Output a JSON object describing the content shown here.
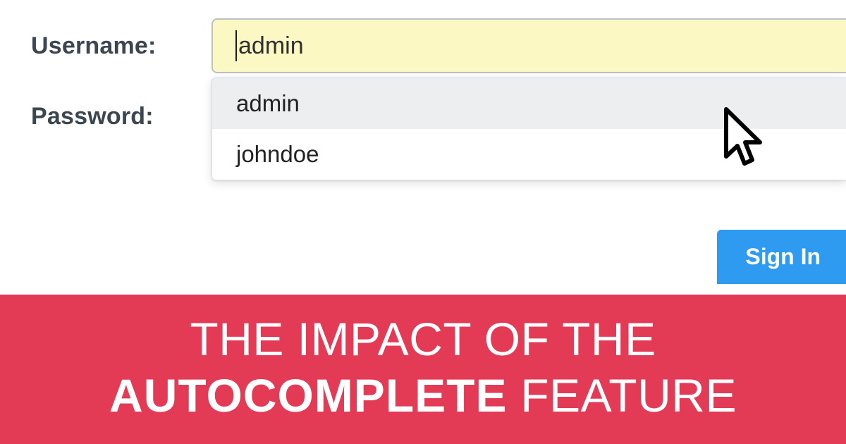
{
  "form": {
    "username_label": "Username:",
    "password_label": "Password:",
    "username_value": "admin"
  },
  "autocomplete": {
    "items": [
      "admin",
      "johndoe"
    ]
  },
  "signin_label": "Sign In",
  "banner": {
    "line1": "THE IMPACT OF THE",
    "line2_bold": "AUTOCOMPLETE",
    "line2_rest": " FEATURE"
  },
  "colors": {
    "accent_button": "#2e9af0",
    "banner_bg": "#e33a55",
    "input_highlight": "#fbf8c3"
  }
}
